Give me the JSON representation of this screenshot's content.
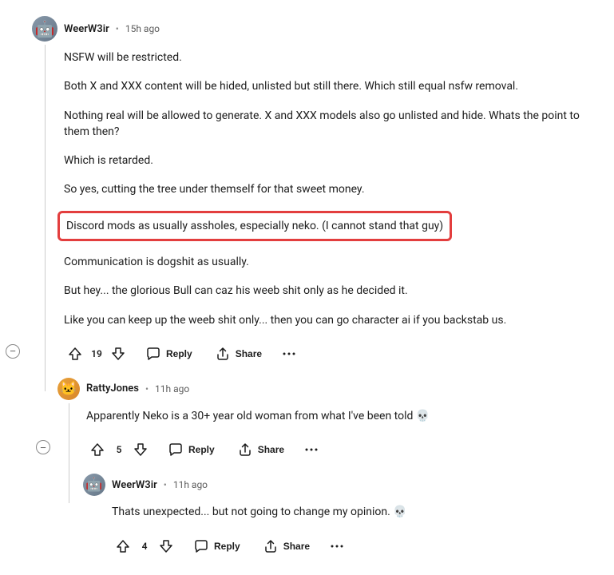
{
  "labels": {
    "reply": "Reply",
    "share": "Share"
  },
  "comments": [
    {
      "username": "WeerW3ir",
      "timestamp": "15h ago",
      "votes": "19",
      "paragraphs": [
        "NSFW will be restricted.",
        "Both X and XXX content will be hided, unlisted but still there. Which still equal nsfw removal.",
        "Nothing real will be allowed to generate. X and XXX models also go unlisted and hide. Whats the point to them then?",
        "Which is retarded.",
        "So yes, cutting the tree under themself for that sweet money.",
        "Discord mods as usually assholes, especially neko. (I cannot stand that guy)",
        "Communication is dogshit as usually.",
        "But hey... the glorious Bull can caz his weeb shit only as he decided it.",
        "Like you can keep up the weeb shit only... then you can go character ai if you backstab us."
      ],
      "highlighted_index": 5,
      "avatar_emoji": "🤖"
    },
    {
      "username": "RattyJones",
      "timestamp": "11h ago",
      "votes": "5",
      "text": "Apparently Neko is a 30+ year old woman from what I've been told 💀",
      "avatar_emoji": "🐱"
    },
    {
      "username": "WeerW3ir",
      "timestamp": "11h ago",
      "votes": "4",
      "text": "Thats unexpected... but not going to change my opinion. 💀",
      "avatar_emoji": "🤖"
    }
  ]
}
